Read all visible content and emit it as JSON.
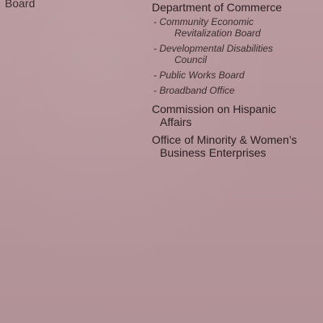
{
  "left_column": {
    "fragment": "Board"
  },
  "right_column": {
    "commerce": {
      "title": "Department of Commerce",
      "items": [
        {
          "line1": "- Community Economic",
          "line2": "Revitalization Board"
        },
        {
          "line1": "- Developmental Disabilities",
          "line2": "Council"
        },
        {
          "line1": "- Public Works Board",
          "line2": ""
        },
        {
          "line1": "- Broadband Office",
          "line2": ""
        }
      ]
    },
    "hispanic": {
      "line1": "Commission on Hispanic",
      "line2": "Affairs"
    },
    "minority": {
      "line1": "Office of Minority & Women’s",
      "line2": "Business Enterprises"
    }
  }
}
